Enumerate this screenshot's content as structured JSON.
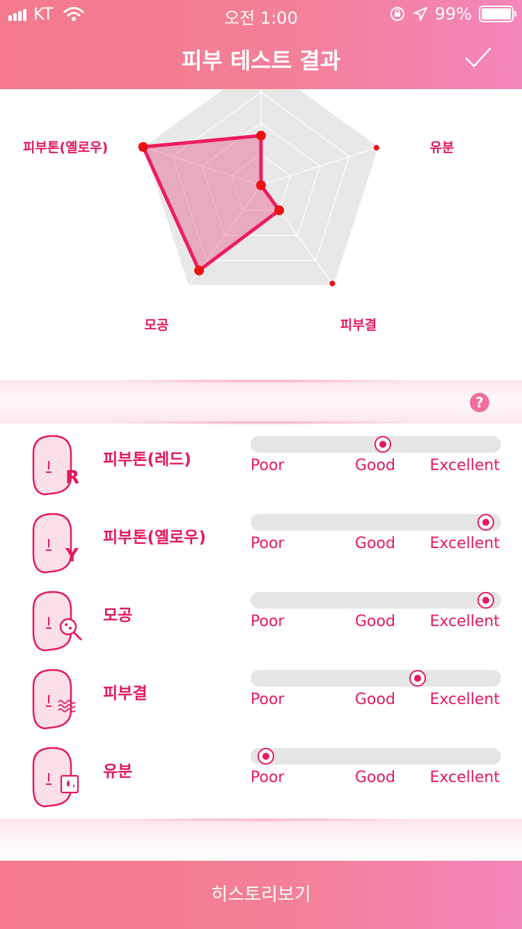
{
  "status_bar": {
    "carrier": "KT",
    "time": "오전 1:00",
    "battery": "99%"
  },
  "header": {
    "title": "피부 테스트 결과"
  },
  "radar": {
    "labels": [
      "유분",
      "피부결",
      "모공",
      "피부톤(옐로우)"
    ],
    "axes": [
      "top",
      "유분",
      "피부결",
      "모공",
      "피부톤(옐로우)"
    ],
    "levels": [
      0.4,
      0.0,
      0.25,
      0.85,
      1.0
    ],
    "fill_color": "#e5195f"
  },
  "metrics": [
    {
      "name": "피부톤(레드)",
      "icon": "face-red-icon",
      "letter": "R",
      "level": 0.53
    },
    {
      "name": "피부톤(옐로우)",
      "icon": "face-yellow-icon",
      "letter": "Y",
      "level": 0.97
    },
    {
      "name": "모공",
      "icon": "face-pore-icon",
      "letter": "",
      "level": 0.97
    },
    {
      "name": "피부결",
      "icon": "face-texture-icon",
      "letter": "",
      "level": 0.68
    },
    {
      "name": "유분",
      "icon": "face-oil-icon",
      "letter": "",
      "level": 0.03
    }
  ],
  "scale": {
    "poor": "Poor",
    "good": "Good",
    "excellent": "Excellent"
  },
  "footer": {
    "history_label": "히스토리보기"
  },
  "colors": {
    "accent": "#e5195f",
    "header_start": "#f47a8c",
    "header_end": "#f386ba"
  }
}
